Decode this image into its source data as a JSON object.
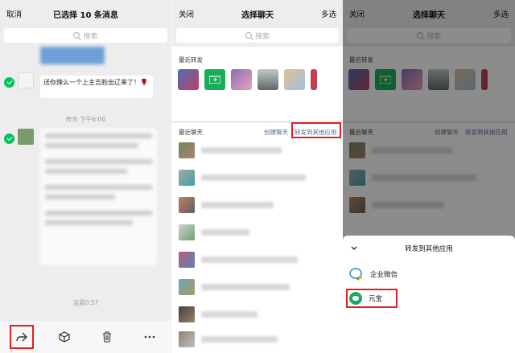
{
  "left_panel": {
    "cancel": "取消",
    "title": "已选择 10 条消息",
    "search_placeholder": "搜索",
    "message_text": "送你辣么一个上主吉脸出辽来了！🌹",
    "time_1": "昨天 下午6:00",
    "time_2": "凌晨0:57"
  },
  "middle_panel": {
    "close": "关闭",
    "title": "选择聊天",
    "multi": "多选",
    "search_placeholder": "搜索",
    "recent_forward": "最近转发",
    "recent_chats": "最近聊天",
    "create_chat": "创建聊天",
    "forward_other": "转发到其他应用"
  },
  "right_panel": {
    "close": "关闭",
    "title": "选择聊天",
    "multi": "多选",
    "search_placeholder": "搜索",
    "recent_forward": "最近转发",
    "recent_chats": "最近聊天",
    "create_chat": "创建聊天",
    "forward_other": "转发到其他应用",
    "sheet_title": "转发到其他应用",
    "apps": [
      "企业微信",
      "元宝"
    ]
  },
  "colors": {
    "accent_green": "#07c160",
    "highlight_red": "#e02020",
    "link_blue": "#576b95"
  }
}
